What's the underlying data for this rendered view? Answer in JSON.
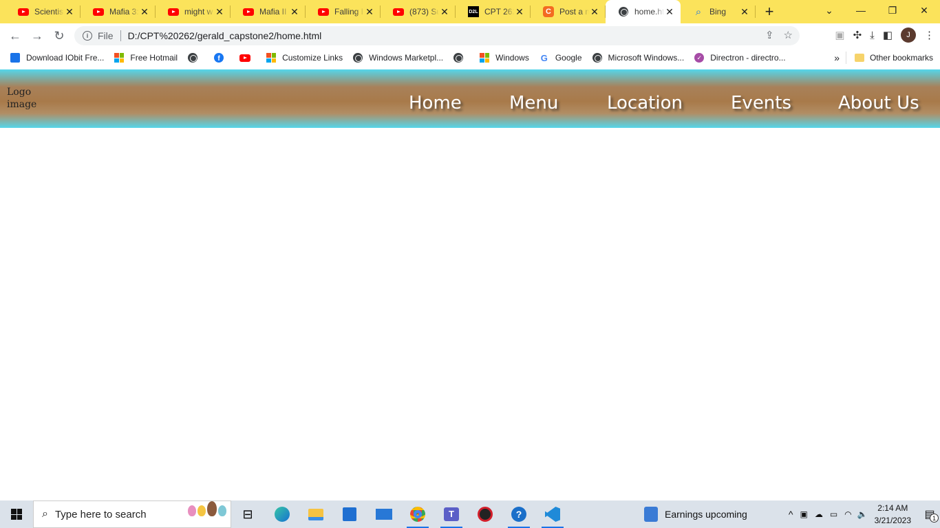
{
  "browser": {
    "tabs": [
      {
        "title": "Scientist",
        "icon": "youtube-icon"
      },
      {
        "title": "Mafia 3:",
        "icon": "youtube-icon"
      },
      {
        "title": "might w",
        "icon": "youtube-icon"
      },
      {
        "title": "Mafia II",
        "icon": "youtube-icon"
      },
      {
        "title": "Falling I",
        "icon": "youtube-icon"
      },
      {
        "title": "(873) Su",
        "icon": "youtube-icon"
      },
      {
        "title": "CPT 262",
        "icon": "d2l-icon"
      },
      {
        "title": "Post a n",
        "icon": "chegg-icon"
      },
      {
        "title": "home.ht",
        "icon": "globe-icon",
        "active": true
      },
      {
        "title": "Bing",
        "icon": "search-icon"
      }
    ],
    "address": {
      "scheme_label": "File",
      "url": "D:/CPT%20262/gerald_capstone2/home.html"
    },
    "profile_initial": "J",
    "bookmarks": [
      {
        "label": "Download IObit Fre...",
        "icon": "iobit-icon"
      },
      {
        "label": "Free Hotmail",
        "icon": "microsoft-icon"
      },
      {
        "label": "",
        "icon": "globe-icon"
      },
      {
        "label": "",
        "icon": "facebook-icon"
      },
      {
        "label": "",
        "icon": "youtube-icon"
      },
      {
        "label": "Customize Links",
        "icon": "microsoft-icon"
      },
      {
        "label": "Windows Marketpl...",
        "icon": "globe-icon"
      },
      {
        "label": "",
        "icon": "globe-icon"
      },
      {
        "label": "Windows",
        "icon": "microsoft-icon"
      },
      {
        "label": "Google",
        "icon": "google-icon"
      },
      {
        "label": "Microsoft Windows...",
        "icon": "globe-icon"
      },
      {
        "label": "Directron - directro...",
        "icon": "directron-icon"
      }
    ],
    "bookmarks_more": "»",
    "other_bookmarks": "Other bookmarks"
  },
  "site": {
    "logo_alt": "Logo image",
    "nav": [
      "Home",
      "Menu",
      "Location",
      "Events",
      "About Us"
    ],
    "colors": {
      "header_edge": "#55d6ea",
      "header_mid": "#a87a4a"
    }
  },
  "taskbar": {
    "search_placeholder": "Type here to search",
    "weather_text": "Earnings upcoming",
    "time": "2:14 AM",
    "date": "3/21/2023",
    "notification_count": "1"
  }
}
